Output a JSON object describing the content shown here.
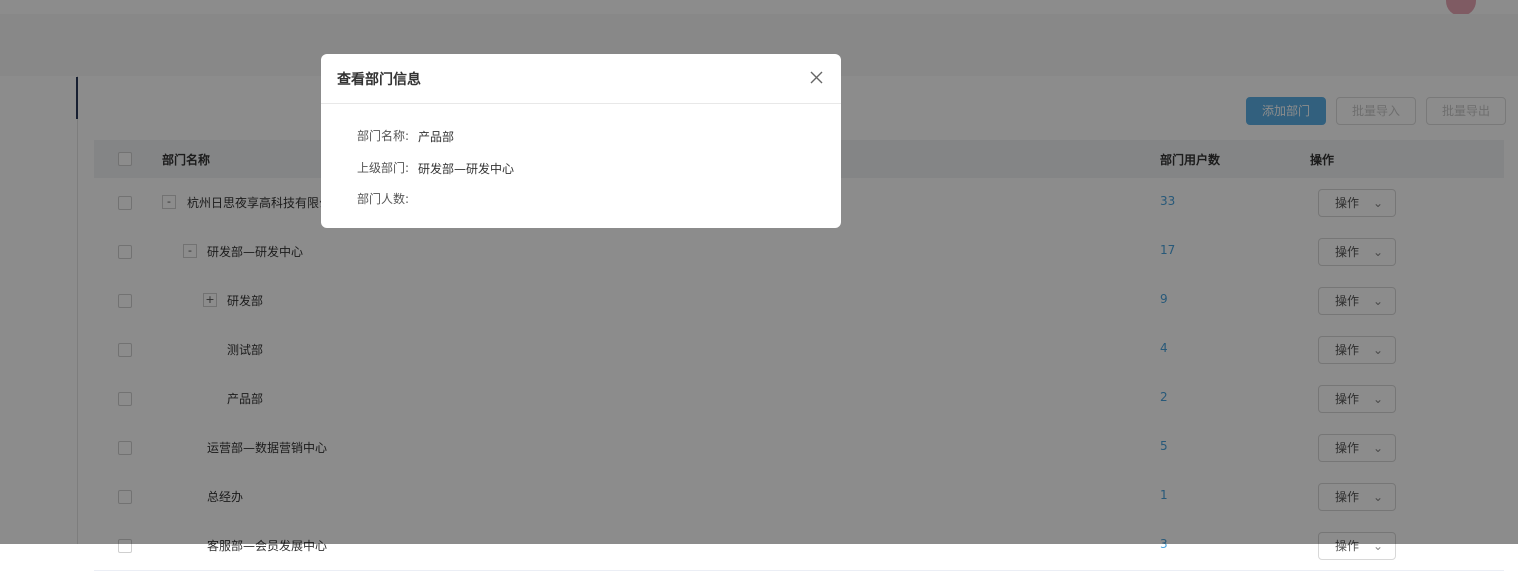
{
  "toolbar": {
    "add_label": "添加部门",
    "import_label": "批量导入",
    "export_label": "批量导出"
  },
  "table": {
    "headers": {
      "name": "部门名称",
      "count": "部门用户数",
      "ops": "操作"
    },
    "rows": [
      {
        "name": "杭州日思夜享高科技有限公司",
        "count": "33",
        "toggle": "-",
        "op": "操作"
      },
      {
        "name": "研发部—研发中心",
        "count": "17",
        "toggle": "-",
        "op": "操作"
      },
      {
        "name": "研发部",
        "count": "9",
        "toggle": "+",
        "op": "操作"
      },
      {
        "name": "测试部",
        "count": "4",
        "op": "操作"
      },
      {
        "name": "产品部",
        "count": "2",
        "op": "操作"
      },
      {
        "name": "运营部—数据营销中心",
        "count": "5",
        "op": "操作"
      },
      {
        "name": "总经办",
        "count": "1",
        "op": "操作"
      },
      {
        "name": "客服部—会员发展中心",
        "count": "3",
        "op": "操作"
      }
    ]
  },
  "modal": {
    "title": "查看部门信息",
    "fields": [
      {
        "label": "部门名称:",
        "value": "产品部"
      },
      {
        "label": "上级部门:",
        "value": "研发部—研发中心"
      },
      {
        "label": "部门人数:",
        "value": ""
      }
    ]
  },
  "colors": {
    "accent": "#5bb0e6",
    "link": "#4aa3dd",
    "overlay": "rgba(0,0,0,0.45)"
  },
  "icons": {
    "close": "close-icon",
    "chevron": "chevron-down-icon"
  }
}
